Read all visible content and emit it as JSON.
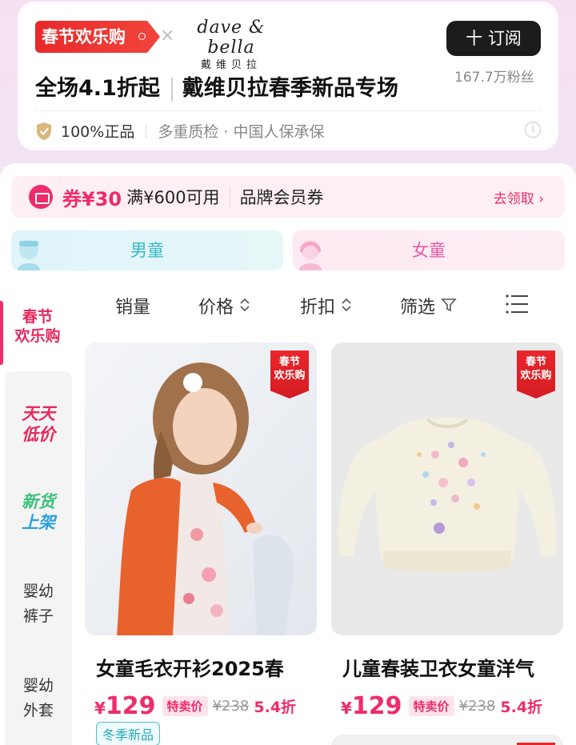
{
  "header": {
    "festival_badge": "春节欢乐购",
    "cross": "×",
    "brand_en": "dave & bella",
    "brand_cn": "戴维贝拉",
    "subscribe_label": "十 订阅",
    "fans": "167.7万粉丝",
    "headline_left": "全场4.1折起",
    "headline_right": "戴维贝拉春季新品专场",
    "trust_main": "100%正品",
    "trust_sub": "多重质检 · 中国人保承保",
    "info": "i"
  },
  "coupon": {
    "amount": "券¥30",
    "condition": "满¥600可用",
    "type": "品牌会员券",
    "action": "去领取 ›"
  },
  "gender_tabs": {
    "boy": "男童",
    "girl": "女童"
  },
  "sidebar": {
    "active": [
      "春节",
      "欢乐购"
    ],
    "promo1": [
      "天天",
      "低价"
    ],
    "promo2": [
      "新货",
      "上架"
    ],
    "item1": [
      "婴幼",
      "裤子"
    ],
    "item2": [
      "婴幼",
      "外套"
    ]
  },
  "sort": {
    "sales": "销量",
    "price": "价格",
    "discount": "折扣",
    "filter": "筛选"
  },
  "products": [
    {
      "fest_tag": [
        "春节",
        "欢乐购"
      ],
      "title": "女童毛衣开衫2025春",
      "currency": "¥",
      "price": "129",
      "badge": "特卖价",
      "original": "¥238",
      "discount": "5.4折",
      "extra_tag": "冬季新品"
    },
    {
      "fest_tag": [
        "春节",
        "欢乐购"
      ],
      "title": "儿童春装卫衣女童洋气",
      "currency": "¥",
      "price": "129",
      "badge": "特卖价",
      "original": "¥238",
      "discount": "5.4折"
    }
  ],
  "colors": {
    "accent": "#ef2c6a",
    "festival_red": "#e8292a",
    "boy": "#35b8c8",
    "girl": "#e558a6"
  }
}
